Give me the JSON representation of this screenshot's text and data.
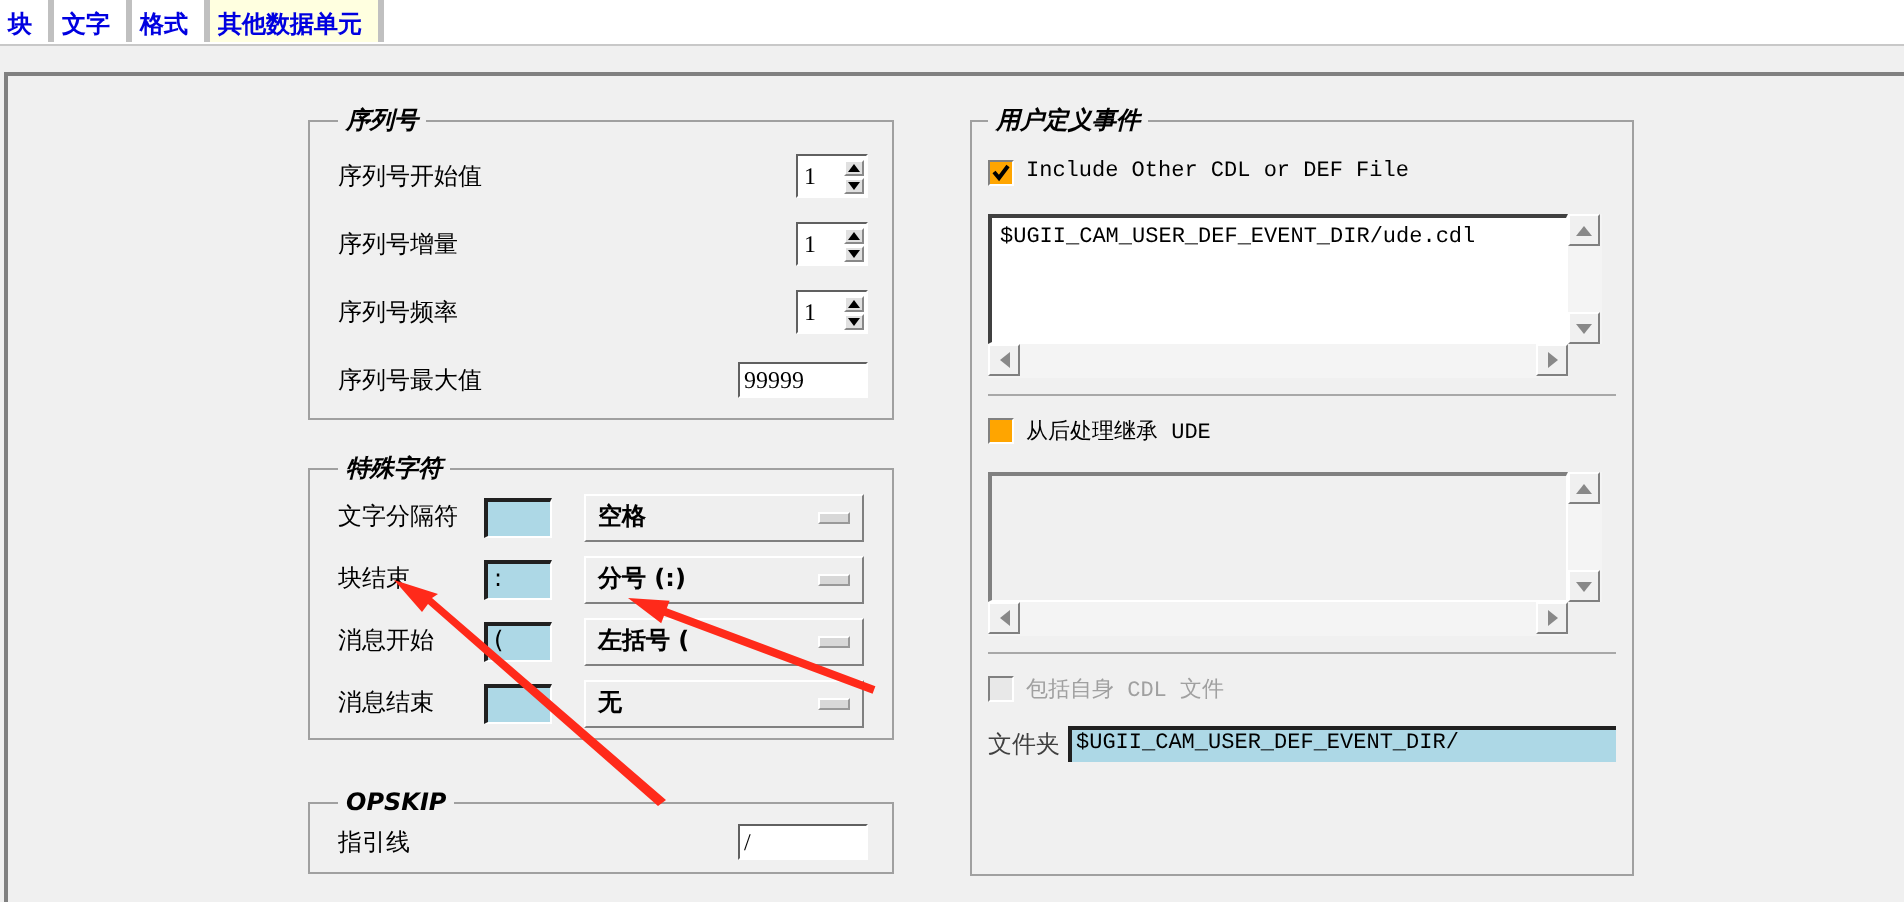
{
  "tabs": [
    {
      "label": "块",
      "selected": false
    },
    {
      "label": "文字",
      "selected": false
    },
    {
      "label": "格式",
      "selected": false
    },
    {
      "label": "其他数据单元",
      "selected": true
    }
  ],
  "sequence_number": {
    "title": "序列号",
    "rows": [
      {
        "kind": "spinner",
        "label": "序列号开始值",
        "value": "1"
      },
      {
        "kind": "spinner",
        "label": "序列号增量",
        "value": "1"
      },
      {
        "kind": "spinner",
        "label": "序列号频率",
        "value": "1"
      },
      {
        "kind": "text",
        "label": "序列号最大值",
        "value": "99999"
      }
    ]
  },
  "special_characters": {
    "title": "特殊字符",
    "rows": [
      {
        "label": "文字分隔符",
        "char": "",
        "option": "空格"
      },
      {
        "label": "块结束",
        "char": ":",
        "option": "分号 (:)"
      },
      {
        "label": "消息开始",
        "char": "(",
        "option": "左括号 ("
      },
      {
        "label": "消息结束",
        "char": "",
        "option": "无"
      }
    ]
  },
  "opskip": {
    "title": "OPSKIP",
    "label": "指引线",
    "value": "/"
  },
  "user_defined_events": {
    "title": "用户定义事件",
    "include_other": {
      "label": "Include Other CDL or DEF File",
      "checked": true,
      "disabled": false
    },
    "include_list": [
      "$UGII_CAM_USER_DEF_EVENT_DIR/ude.cdl"
    ],
    "inherit": {
      "label": "从后处理继承 UDE",
      "checked": false,
      "disabled": false
    },
    "include_own": {
      "label": "包括自身 CDL 文件",
      "checked": false,
      "disabled": true
    },
    "folder": {
      "label": "文件夹",
      "value": "$UGII_CAM_USER_DEF_EVENT_DIR/"
    }
  },
  "annotations": [
    {
      "kind": "arrow"
    },
    {
      "kind": "arrow"
    }
  ]
}
